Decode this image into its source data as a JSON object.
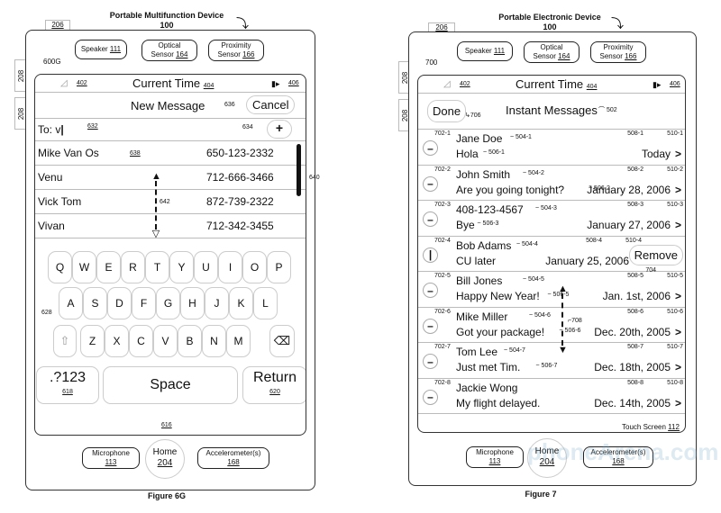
{
  "left": {
    "figure_label": "Figure 6G",
    "device_title": "Portable Multifunction Device",
    "device_ref": "100",
    "tab_top_ref": "206",
    "side_tab_refs": [
      "208",
      "208"
    ],
    "screen_ref": "600G",
    "sensors": [
      {
        "line1": "Speaker",
        "ref": "111"
      },
      {
        "line1": "Optical",
        "line2": "Sensor",
        "ref": "164"
      },
      {
        "line1": "Proximity",
        "line2": "Sensor",
        "ref": "166"
      }
    ],
    "status": {
      "signal_ref": "402",
      "time": "Current Time",
      "time_ref": "404",
      "battery_ref": "406"
    },
    "header": {
      "title": "New Message",
      "cancel_ref": "636",
      "cancel_label": "Cancel"
    },
    "to_field": {
      "label": "To:",
      "value": "v",
      "ref": "632",
      "add_ref": "634",
      "add_label": "+"
    },
    "contacts": [
      {
        "name": "Mike Van Os",
        "phone": "650-123-2332",
        "ref": "638"
      },
      {
        "name": "Venu",
        "phone": "712-666-3466"
      },
      {
        "name": "Vick Tom",
        "phone": "872-739-2322"
      },
      {
        "name": "Vivan",
        "phone": "712-342-3455"
      }
    ],
    "scroll_ref": "642",
    "scrollbar_ref": "640",
    "keyboard": {
      "row1": [
        "Q",
        "W",
        "E",
        "R",
        "T",
        "Y",
        "U",
        "I",
        "O",
        "P"
      ],
      "row2": [
        "A",
        "S",
        "D",
        "F",
        "G",
        "H",
        "J",
        "K",
        "L"
      ],
      "row3": [
        "Z",
        "X",
        "C",
        "V",
        "B",
        "N",
        "M"
      ],
      "shift_ref": "628",
      "numbers_label": ".?123",
      "numbers_ref": "618",
      "space_label": "Space",
      "return_label": "Return",
      "return_ref": "620",
      "keyboard_ref": "616"
    },
    "bottom": [
      {
        "line1": "Microphone",
        "ref": "113"
      },
      {
        "line1": "Home",
        "ref": "204"
      },
      {
        "line1": "Accelerometer(s)",
        "ref": "168"
      }
    ]
  },
  "right": {
    "figure_label": "Figure 7",
    "device_title": "Portable Electronic Device",
    "device_ref": "100",
    "tab_top_ref": "206",
    "side_tab_refs": [
      "208",
      "208"
    ],
    "screen_ref": "700",
    "sensors": [
      {
        "line1": "Speaker",
        "ref": "111"
      },
      {
        "line1": "Optical",
        "line2": "Sensor",
        "ref": "164"
      },
      {
        "line1": "Proximity",
        "line2": "Sensor",
        "ref": "166"
      }
    ],
    "status": {
      "signal_ref": "402",
      "time": "Current Time",
      "time_ref": "404",
      "battery_ref": "406"
    },
    "header": {
      "done_label": "Done",
      "done_ref": "706",
      "title": "Instant Messages",
      "title_ref": "502"
    },
    "messages": [
      {
        "idx": "702-1",
        "name": "Jane Doe",
        "name_ref": "504-1",
        "text": "Hola",
        "text_ref": "506-1",
        "date": "Today",
        "date_ref": "508-1",
        "arrow_ref": "510-1"
      },
      {
        "idx": "702-2",
        "name": "John Smith",
        "name_ref": "504-2",
        "text": "Are you going tonight?",
        "text_ref": "506-2",
        "date": "January 28, 2006",
        "date_ref": "508-2",
        "arrow_ref": "510-2"
      },
      {
        "idx": "702-3",
        "name": "408-123-4567",
        "name_ref": "504-3",
        "text": "Bye",
        "text_ref": "506-3",
        "date": "January 27, 2006",
        "date_ref": "508-3",
        "arrow_ref": "510-3"
      },
      {
        "idx": "702-4",
        "name": "Bob Adams",
        "name_ref": "504-4",
        "text": "CU later",
        "date": "January 25, 2006",
        "date_ref": "508-4",
        "arrow_ref": "510-4",
        "remove_label": "Remove",
        "remove_ref": "704"
      },
      {
        "idx": "702-5",
        "name": "Bill Jones",
        "name_ref": "504-5",
        "text": "Happy New Year!",
        "text_ref": "506-5",
        "date": "Jan. 1st, 2006",
        "date_ref": "508-5",
        "arrow_ref": "510-5"
      },
      {
        "idx": "702-6",
        "name": "Mike Miller",
        "name_ref": "504-6",
        "text": "Got your package!",
        "text_ref": "506-6",
        "date": "Dec. 20th, 2005",
        "date_ref": "508-6",
        "arrow_ref": "510-6"
      },
      {
        "idx": "702-7",
        "name": "Tom Lee",
        "name_ref": "504-7",
        "text": "Just met Tim.",
        "text_ref": "506-7",
        "date": "Dec. 18th, 2005",
        "date_ref": "508-7",
        "arrow_ref": "510-7"
      },
      {
        "idx": "702-8",
        "name": "Jackie Wong",
        "text": "My flight delayed.",
        "date": "Dec. 14th, 2005",
        "date_ref": "508-8",
        "arrow_ref": "510-8"
      }
    ],
    "scroll_ref": "708",
    "touch_screen_label": "Touch Screen",
    "touch_screen_ref": "112",
    "bottom": [
      {
        "line1": "Microphone",
        "ref": "113"
      },
      {
        "line1": "Home",
        "ref": "204"
      },
      {
        "line1": "Accelerometer(s)",
        "ref": "168"
      }
    ]
  },
  "watermark": "phoneArena.com"
}
